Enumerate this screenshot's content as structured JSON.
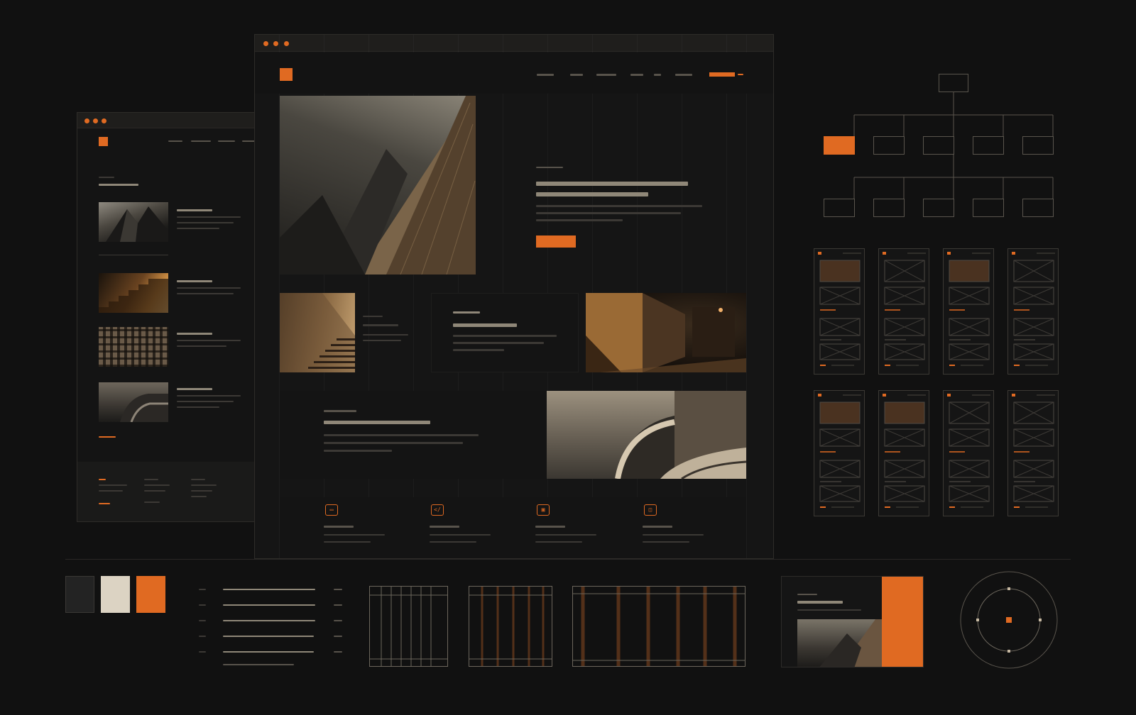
{
  "colors": {
    "background": "#111111",
    "accent": "#e06a22",
    "swatch_dark": "#232323",
    "swatch_light": "#dcd3c3",
    "swatch_orange": "#e06a22"
  },
  "main_window": {
    "nav_items": [
      "",
      "",
      "",
      "",
      "",
      ""
    ],
    "hero": {
      "eyebrow": "",
      "title": "",
      "cta": ""
    },
    "features": [
      {
        "icon": "folder-icon",
        "glyph": "▭"
      },
      {
        "icon": "code-icon",
        "glyph": "</"
      },
      {
        "icon": "image-icon",
        "glyph": "▣"
      },
      {
        "icon": "lock-icon",
        "glyph": "◫"
      }
    ]
  },
  "sitemap": {
    "root": "",
    "level1": [
      "",
      "",
      "",
      "",
      ""
    ],
    "level2": [
      "",
      "",
      "",
      "",
      ""
    ]
  },
  "wireframes": {
    "count": 8
  }
}
